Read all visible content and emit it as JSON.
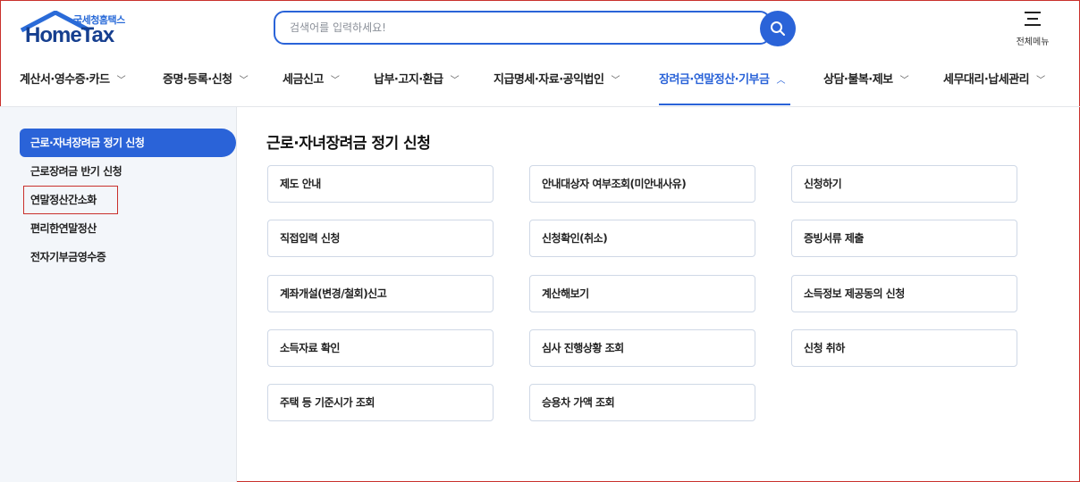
{
  "header": {
    "logo_sub": "국세청홈택스",
    "logo_main": "HomeTax",
    "search_placeholder": "검색어를 입력하세요!",
    "all_menu_label": "전체메뉴"
  },
  "gnb": {
    "items": [
      {
        "label": "계산서·영수증·카드",
        "chevron": "chevron-down"
      },
      {
        "label": "증명·등록·신청",
        "chevron": "chevron-down"
      },
      {
        "label": "세금신고",
        "chevron": "chevron-down"
      },
      {
        "label": "납부·고지·환급",
        "chevron": "chevron-down"
      },
      {
        "label": "지급명세·자료·공익법인",
        "chevron": "chevron-down"
      },
      {
        "label": "장려금·연말정산·기부금",
        "chevron": "chevron-up",
        "active": true
      },
      {
        "label": "상담·불복·제보",
        "chevron": "chevron-down"
      },
      {
        "label": "세무대리·납세관리",
        "chevron": "chevron-down"
      }
    ],
    "chevron_down_glyph": "﹀",
    "chevron_up_glyph": "︿"
  },
  "sidebar": {
    "items": [
      {
        "label": "근로·자녀장려금 정기 신청",
        "active": true
      },
      {
        "label": "근로장려금 반기 신청"
      },
      {
        "label": "연말정산간소화",
        "highlighted": true
      },
      {
        "label": "편리한연말정산"
      },
      {
        "label": "전자기부금영수증"
      }
    ]
  },
  "main": {
    "title": "근로·자녀장려금 정기 신청",
    "cards": [
      "제도 안내",
      "안내대상자 여부조회(미안내사유)",
      "신청하기",
      "직접입력 신청",
      "신청확인(취소)",
      "증빙서류 제출",
      "계좌개설(변경/철회)신고",
      "계산해보기",
      "소득정보 제공동의 신청",
      "소득자료 확인",
      "심사 진행상황 조회",
      "신청 취하",
      "주택 등 기준시가 조회",
      "승용차 가액 조회"
    ]
  },
  "colors": {
    "brand_blue": "#2a63d8",
    "logo_navy": "#163f8f",
    "highlight_red": "#c9302c",
    "sidebar_bg": "#f3f6fa",
    "card_border": "#cfd8e6"
  },
  "icons": {
    "search": "search-icon",
    "menu": "hamburger-menu-icon",
    "logo": "house-roof-icon"
  }
}
